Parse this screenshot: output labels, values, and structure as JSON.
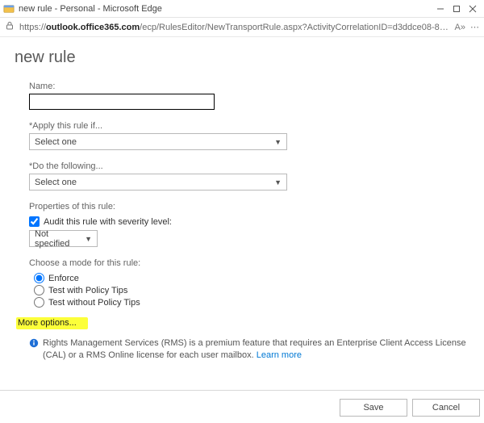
{
  "window": {
    "title": "new rule - Personal - Microsoft Edge"
  },
  "address": {
    "protocol": "https://",
    "host": "outlook.office365.com",
    "path": "/ecp/RulesEditor/NewTransportRule.aspx?ActivityCorrelationID=d3ddce08-8b19-8a4d-4...",
    "reading_badge": "A»"
  },
  "page": {
    "title": "new rule",
    "name_label": "Name:",
    "name_value": "",
    "apply_if_label": "*Apply this rule if...",
    "apply_if_value": "Select one",
    "do_following_label": "*Do the following...",
    "do_following_value": "Select one",
    "properties_heading": "Properties of this rule:",
    "audit_label": "Audit this rule with severity level:",
    "audit_checked": true,
    "severity_value": "Not specified",
    "mode_heading": "Choose a mode for this rule:",
    "modes": {
      "enforce": "Enforce",
      "test_with": "Test with Policy Tips",
      "test_without": "Test without Policy Tips"
    },
    "mode_selected": "enforce",
    "more_options": "More options...",
    "info_text": "Rights Management Services (RMS) is a premium feature that requires an Enterprise Client Access License (CAL) or a RMS Online license for each user mailbox. ",
    "learn_more": "Learn more",
    "save": "Save",
    "cancel": "Cancel"
  }
}
